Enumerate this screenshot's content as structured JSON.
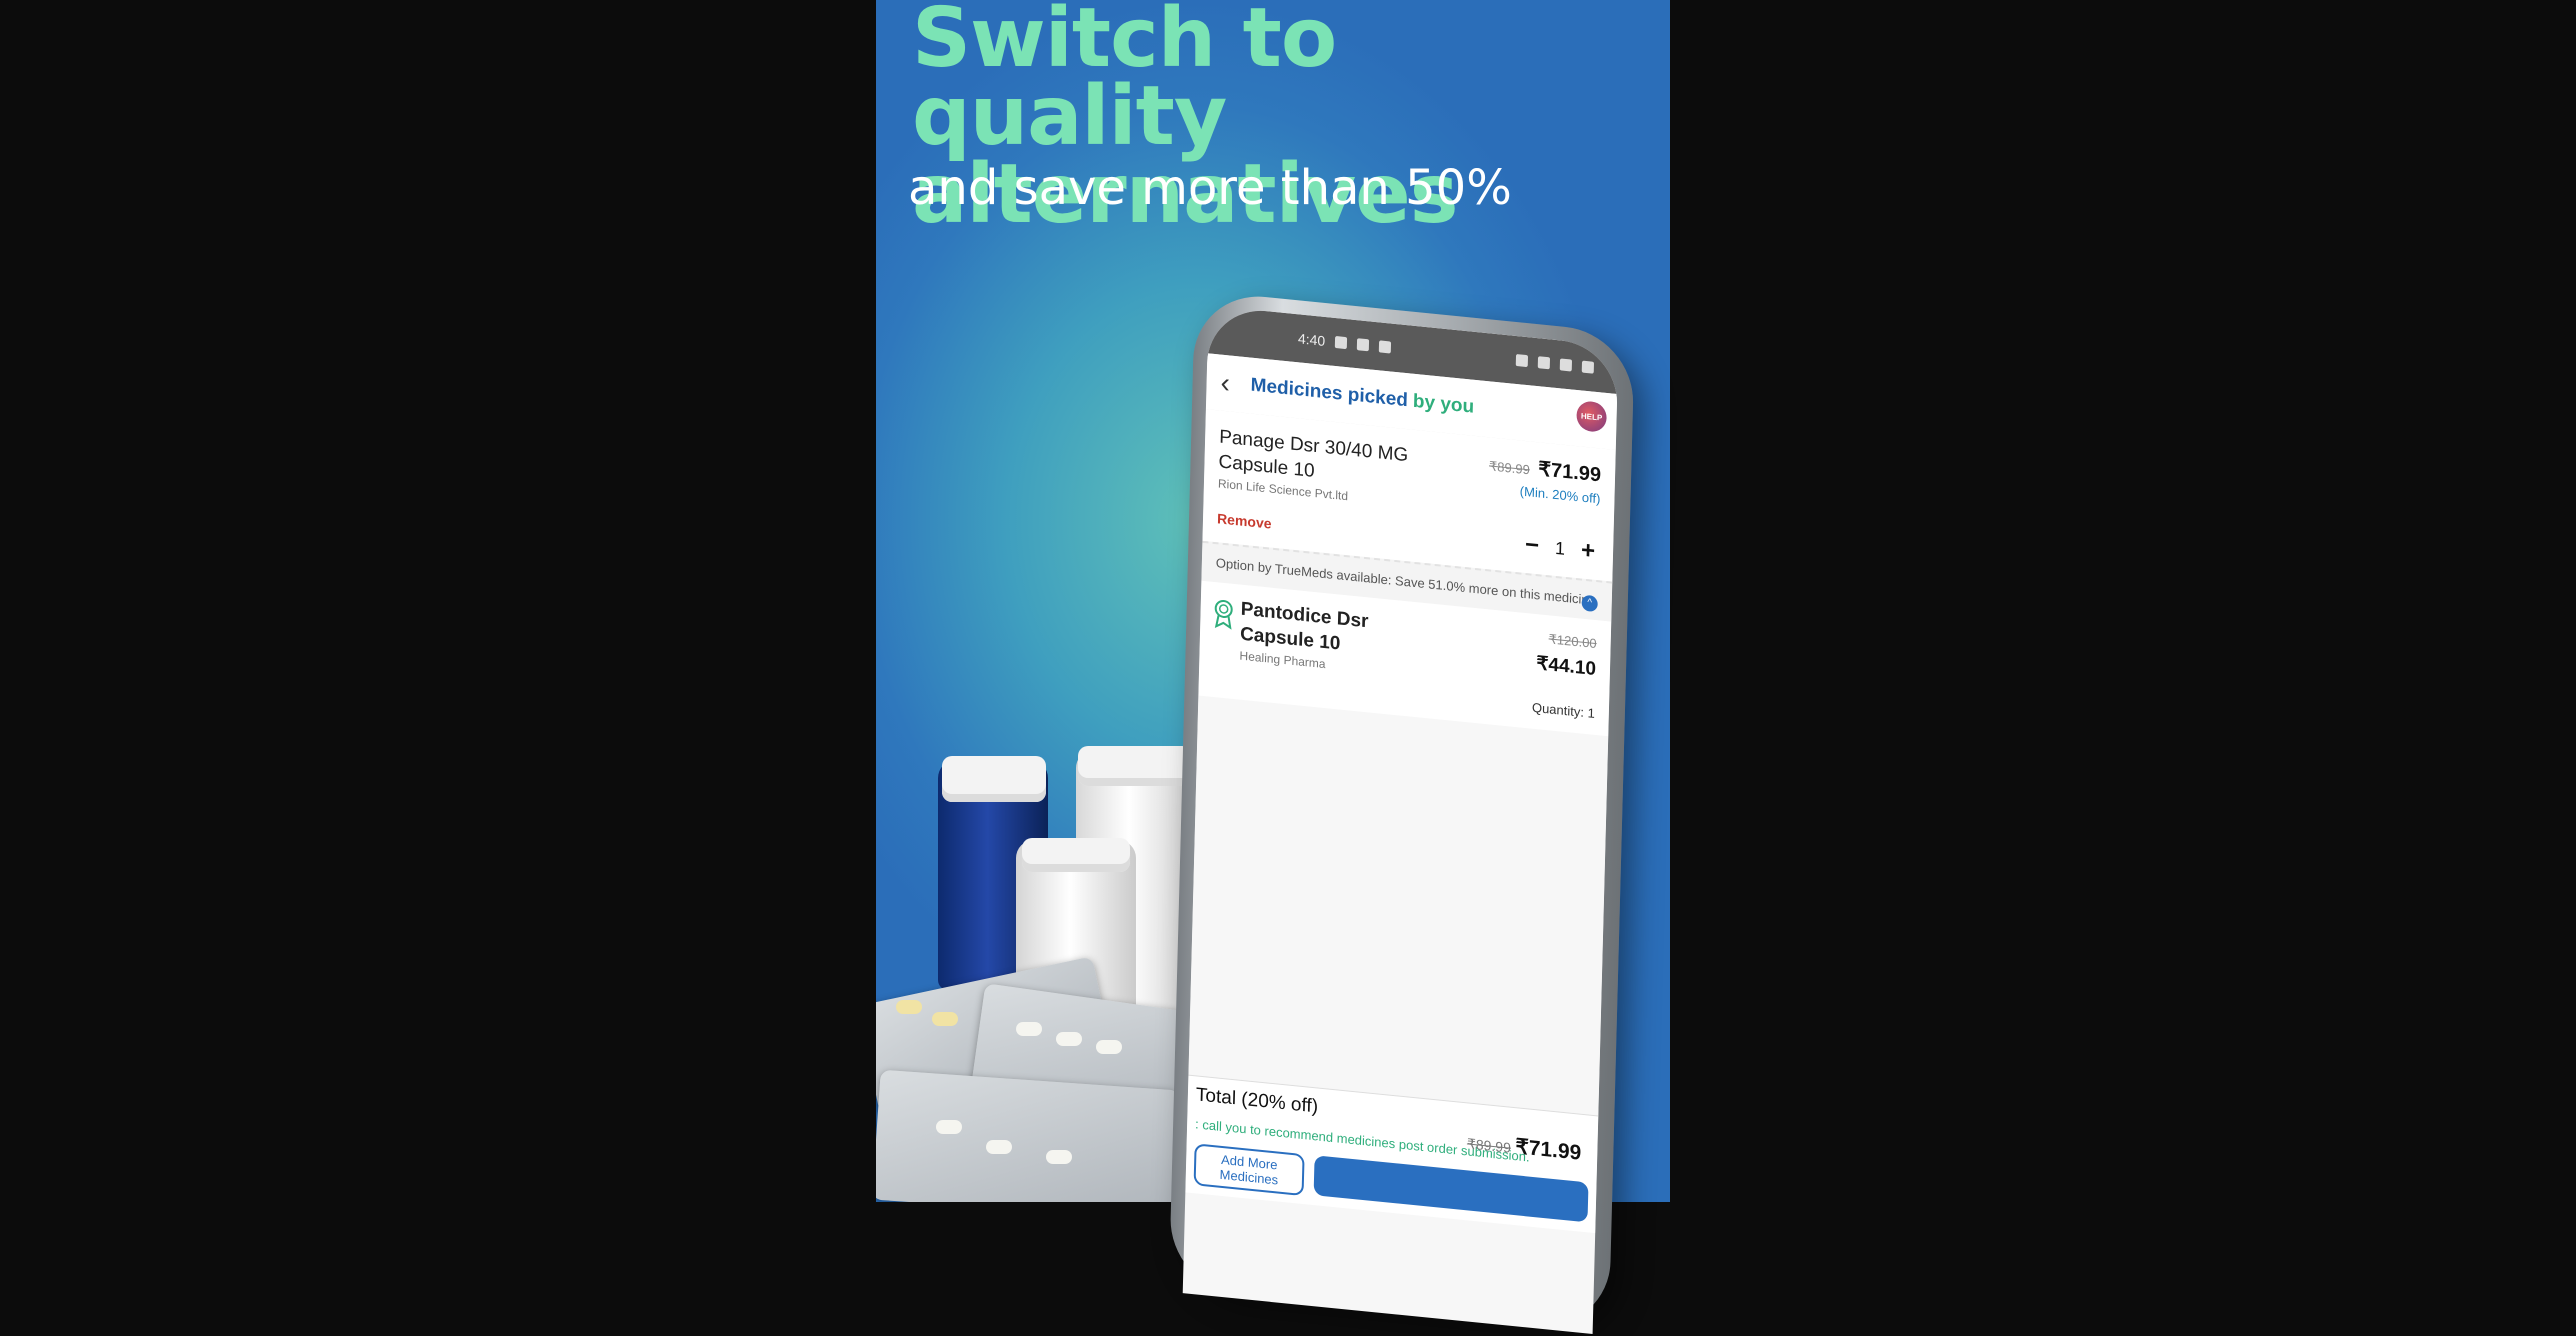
{
  "banner": {
    "headline": "Switch to quality alternatives",
    "subline": "and save more than 50%"
  },
  "status_bar": {
    "time": "4:40"
  },
  "app_bar": {
    "title_part1": "Medicines picked",
    "title_part2": "by you",
    "help_label": "HELP"
  },
  "picked_medicine": {
    "name": "Panage Dsr 30/40 MG Capsule 10",
    "manufacturer": "Rion Life Science Pvt.ltd",
    "mrp": "₹89.99",
    "price": "₹71.99",
    "discount": "(Min. 20% off)",
    "remove_label": "Remove",
    "quantity": "1",
    "minus": "−",
    "plus": "+"
  },
  "alternative_note": "Option by TrueMeds available: Save 51.0% more on this medicine",
  "alternative": {
    "name": "Pantodice Dsr Capsule 10",
    "manufacturer": "Healing Pharma",
    "mrp": "₹120.00",
    "price": "₹44.10",
    "quantity_label": "Quantity: 1"
  },
  "footer": {
    "total_label": "Total (20% off)",
    "total_mrp": "₹89.99",
    "total_price": "₹71.99",
    "callout": ": call you to recommend medicines post order submission.",
    "add_more_label": "Add More Medicines"
  },
  "colors": {
    "headline": "#7be3b5",
    "brand_blue": "#2a6fc0",
    "brand_green": "#2fae7c",
    "remove_red": "#c73a2e"
  }
}
